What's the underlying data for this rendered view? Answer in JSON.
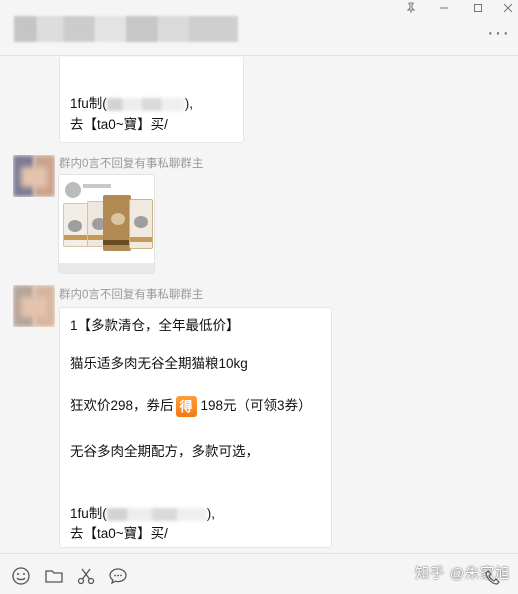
{
  "window": {
    "pin_icon": "pin-icon",
    "min_icon": "minimize-icon",
    "max_icon": "maximize-icon",
    "close_icon": "close-icon",
    "more_label": "···"
  },
  "messages": [
    {
      "type": "text",
      "lines_top": [
        "1fu制(",
        "),",
        "去【ta0~寶】买/"
      ]
    },
    {
      "type": "image",
      "sender": "群内0言不回复有事私聊群主"
    },
    {
      "type": "text",
      "sender": "群内0言不回复有事私聊群主",
      "line1": "1【多款清仓，全年最低价】",
      "line2": "猫乐适多肉无谷全期猫粮10kg",
      "line3_pre": "狂欢价298，券后",
      "badge": "得",
      "line3_post": "198元（可领3券）",
      "line4": "无谷多肉全期配方，多款可选，",
      "line5_pre": "1fu制(",
      "line5_post": "),",
      "line6": "去【ta0~寶】买/"
    }
  ],
  "toolbar": {
    "emoji_icon": "emoji-icon",
    "folder_icon": "folder-icon",
    "scissors_icon": "scissors-icon",
    "chat_icon": "chat-bubble-icon",
    "phone_icon": "phone-icon"
  },
  "watermark": "知乎 @朱家旭"
}
